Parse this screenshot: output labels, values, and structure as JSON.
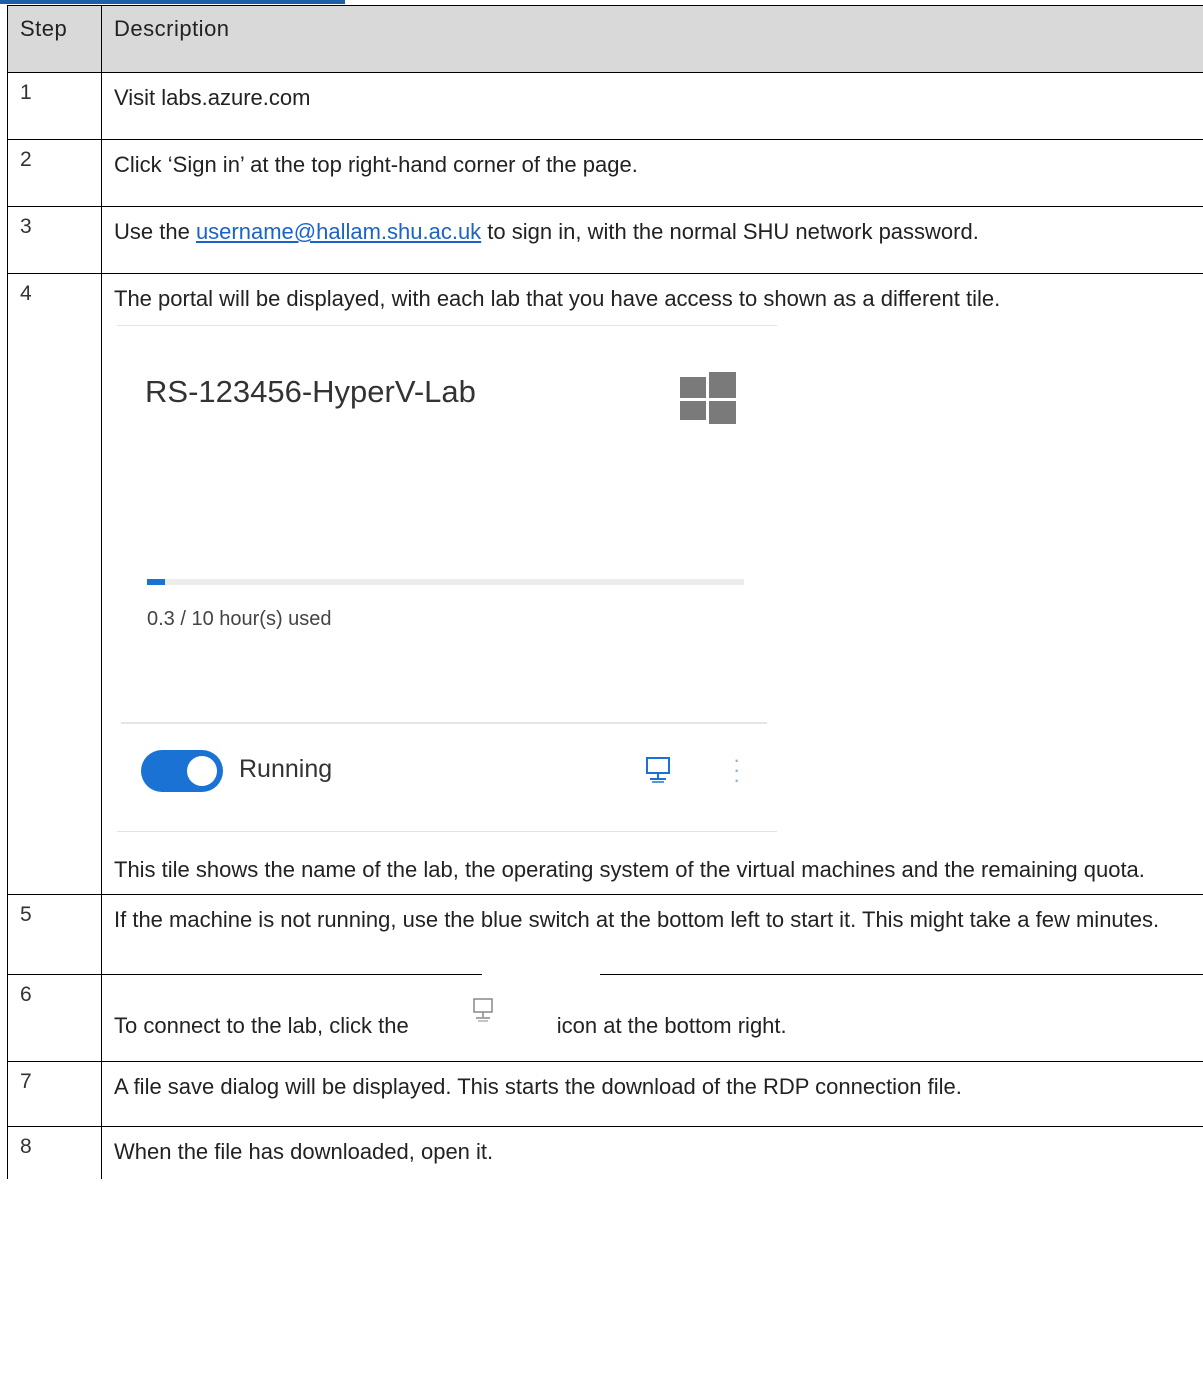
{
  "header": {
    "step": "Step",
    "description": "Description"
  },
  "rows": {
    "r1": {
      "step": "1",
      "text": "Visit labs.azure.com"
    },
    "r2": {
      "step": "2",
      "text": "Click ‘Sign in’ at the top right-hand corner of the page."
    },
    "r3": {
      "step": "3",
      "text_before": "Use the ",
      "link": "username@hallam.shu.ac.uk",
      "text_after": " to sign in, with the normal SHU network password."
    },
    "r4": {
      "step": "4",
      "text": "The portal will be displayed, with each lab that you have access to shown as a different tile.",
      "after_text": "This tile shows the name of the lab, the operating system of the virtual machines and the remaining quota."
    },
    "r5": {
      "step": "5",
      "text": "If the machine is not running, use the blue switch at the bottom left to start it.  This might take a few minutes."
    },
    "r6": {
      "step": "6",
      "text_before": "To connect to the lab, click the",
      "text_after": "icon at the bottom right."
    },
    "r7": {
      "step": "7",
      "text": "A file save dialog will be displayed.  This starts the download of the RDP connection file."
    },
    "r8": {
      "step": "8",
      "text": "When the file has downloaded, open it."
    }
  },
  "tile": {
    "lab_name": "RS-123456-HyperV-Lab",
    "os_icon": "windows-logo-icon",
    "usage_text": "0.3 / 10 hour(s) used",
    "usage_hours": 0.3,
    "quota_hours": 10,
    "status": "Running",
    "toggle_on": true,
    "connect_icon": "monitor-icon",
    "more_icon": "more-vertical-icon"
  },
  "colors": {
    "accent": "#1a73d4",
    "link": "#1a63c7",
    "header_bg": "#d9d9d9"
  }
}
